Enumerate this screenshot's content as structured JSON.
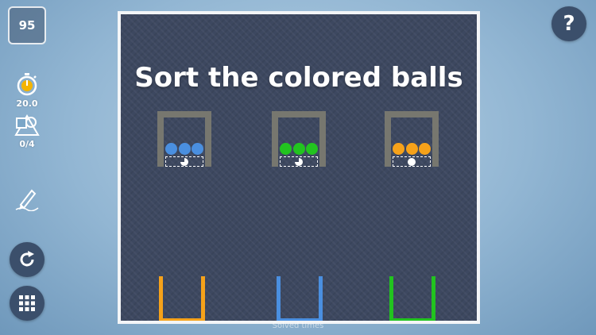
{
  "level": "95",
  "timer": {
    "icon": "stopwatch-icon",
    "value": "20.0"
  },
  "shapes": {
    "icon": "shapes-icon",
    "value": "0/4"
  },
  "tools": {
    "draw": "pencil-icon",
    "restart": "restart-icon",
    "menu": "grid-menu-icon",
    "help_label": "?"
  },
  "board": {
    "title": "Sort the colored balls",
    "dispensers": [
      {
        "color": "#4a8fe0",
        "balls": 3,
        "slot_dot": "partial"
      },
      {
        "color": "#22c41f",
        "balls": 3,
        "slot_dot": "partial"
      },
      {
        "color": "#f6a21a",
        "balls": 3,
        "slot_dot": "full"
      }
    ],
    "buckets": [
      {
        "color": "#f6a21a"
      },
      {
        "color": "#4a8fe0"
      },
      {
        "color": "#22c41f"
      }
    ]
  },
  "footer": {
    "text": "Solved  times"
  },
  "colors": {
    "frame": "#f3f5f7",
    "board_bg": "#3d4860",
    "dispenser": "#77776f",
    "button_bg": "#3b4f6b"
  }
}
